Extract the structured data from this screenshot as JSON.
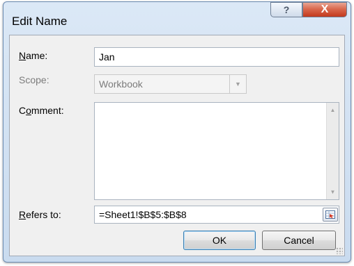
{
  "window": {
    "title": "Edit Name",
    "help_glyph": "?",
    "close_glyph": "X"
  },
  "form": {
    "name": {
      "label_u": "N",
      "label_rest": "ame:",
      "value": "Jan"
    },
    "scope": {
      "label": "Scope:",
      "value": "Workbook"
    },
    "comment": {
      "label_pre": "C",
      "label_u": "o",
      "label_rest": "mment:",
      "value": ""
    },
    "refers_to": {
      "label_u": "R",
      "label_rest": "efers to:",
      "value": "=Sheet1!$B$5:$B$8"
    }
  },
  "buttons": {
    "ok": "OK",
    "cancel": "Cancel"
  },
  "icons": {
    "help": "help-icon",
    "close": "close-icon",
    "dropdown": "chevron-down-icon",
    "scroll_up": "scroll-up-icon",
    "scroll_down": "scroll-down-icon",
    "range_picker": "collapse-dialog-icon"
  },
  "colors": {
    "close_button": "#c2391d",
    "title_bar": "#c9dbef",
    "client_bg": "#f0f0f0"
  }
}
